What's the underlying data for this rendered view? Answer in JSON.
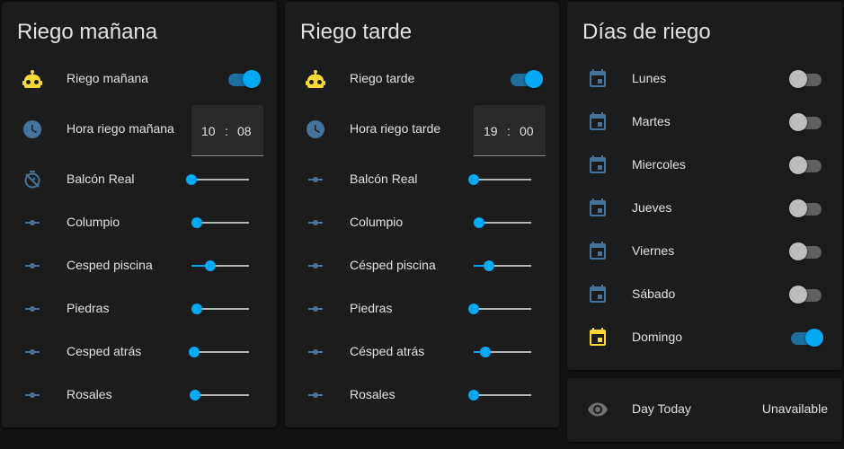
{
  "colors": {
    "accent": "#03a9f4",
    "icon": "#44739e",
    "robot": "#fdd835",
    "calendar_active": "#fdd835",
    "card": "#1c1c1c",
    "background": "#111111"
  },
  "card_manana": {
    "title": "Riego mañana",
    "toggle_label": "Riego mañana",
    "toggle_on": true,
    "time_label": "Hora riego mañana",
    "hour": "10",
    "sep": ":",
    "minute": "08",
    "sliders": [
      {
        "label": "Balcón Real",
        "icon": "timer-off-icon",
        "value": 0.0
      },
      {
        "label": "Columpio",
        "icon": "valve-icon",
        "value": 0.1
      },
      {
        "label": "Cesped piscina",
        "icon": "valve-icon",
        "value": 0.33
      },
      {
        "label": "Piedras",
        "icon": "valve-icon",
        "value": 0.1
      },
      {
        "label": "Cesped atrás",
        "icon": "valve-icon",
        "value": 0.05
      },
      {
        "label": "Rosales",
        "icon": "valve-icon",
        "value": 0.06
      }
    ]
  },
  "card_tarde": {
    "title": "Riego tarde",
    "toggle_label": "Riego tarde",
    "toggle_on": true,
    "time_label": "Hora riego tarde",
    "hour": "19",
    "sep": ":",
    "minute": "00",
    "sliders": [
      {
        "label": "Balcón Real",
        "icon": "valve-icon",
        "value": 0.0
      },
      {
        "label": "Columpio",
        "icon": "valve-icon",
        "value": 0.1
      },
      {
        "label": "Césped piscina",
        "icon": "valve-icon",
        "value": 0.27
      },
      {
        "label": "Piedras",
        "icon": "valve-icon",
        "value": 0.0
      },
      {
        "label": "Césped atrás",
        "icon": "valve-icon",
        "value": 0.2
      },
      {
        "label": "Rosales",
        "icon": "valve-icon",
        "value": 0.0
      }
    ]
  },
  "card_dias": {
    "title": "Días de riego",
    "days": [
      {
        "label": "Lunes",
        "on": false
      },
      {
        "label": "Martes",
        "on": false
      },
      {
        "label": "Miercoles",
        "on": false
      },
      {
        "label": "Jueves",
        "on": false
      },
      {
        "label": "Viernes",
        "on": false
      },
      {
        "label": "Sábado",
        "on": false
      },
      {
        "label": "Domingo",
        "on": true
      }
    ]
  },
  "card_today": {
    "label": "Day Today",
    "value": "Unavailable",
    "icon": "eye-icon"
  }
}
